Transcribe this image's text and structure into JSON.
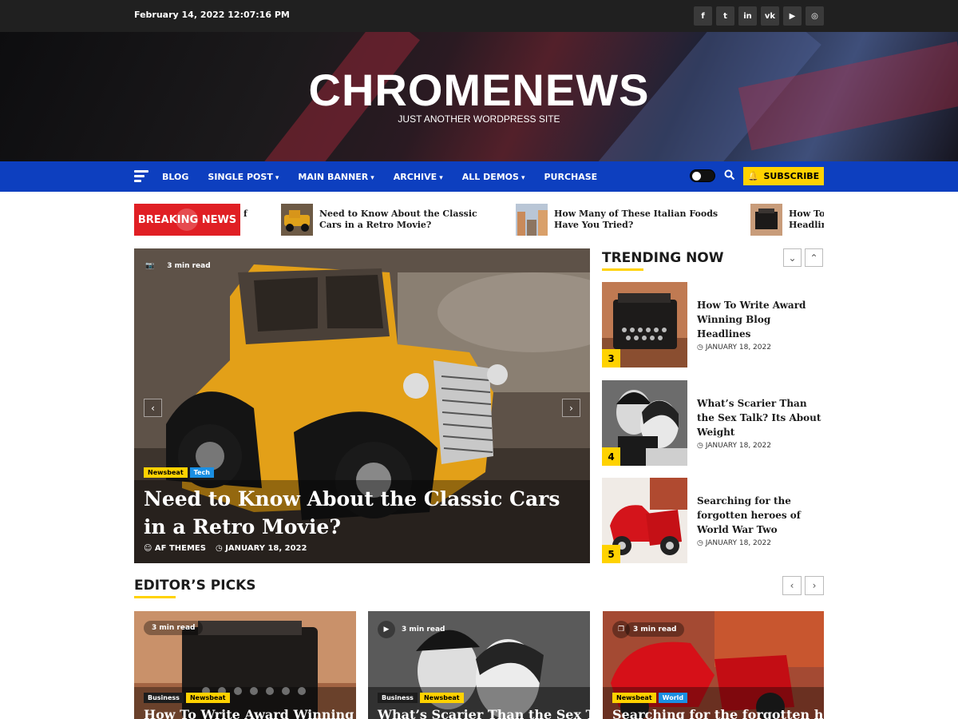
{
  "topbar": {
    "datetime": "February 14, 2022 12:07:16 PM",
    "socials": [
      {
        "icon": "facebook-icon",
        "glyph": "f"
      },
      {
        "icon": "twitter-icon",
        "glyph": "t"
      },
      {
        "icon": "linkedin-icon",
        "glyph": "in"
      },
      {
        "icon": "vk-icon",
        "glyph": "vk"
      },
      {
        "icon": "youtube-icon",
        "glyph": "▶"
      },
      {
        "icon": "instagram-icon",
        "glyph": "◎"
      }
    ]
  },
  "header": {
    "site_title": "CHROMENEWS",
    "site_description": "JUST ANOTHER WORDPRESS SITE"
  },
  "nav": {
    "items": [
      {
        "label": "BLOG",
        "dropdown": false
      },
      {
        "label": "SINGLE POST",
        "dropdown": true
      },
      {
        "label": "MAIN BANNER",
        "dropdown": true
      },
      {
        "label": "ARCHIVE",
        "dropdown": true
      },
      {
        "label": "ALL DEMOS",
        "dropdown": true
      },
      {
        "label": "PURCHASE",
        "dropdown": false
      }
    ],
    "subscribe_label": "SUBSCRIBE"
  },
  "breaking": {
    "label": "BREAKING NEWS",
    "fragment": "f",
    "items": [
      "Need to Know About the Classic Cars in a Retro Movie?",
      "How Many of These Italian Foods Have You Tried?",
      "How To Write Award Winning Blog Headlines"
    ]
  },
  "banner": {
    "read_time": "3 min read",
    "categories": [
      "Newsbeat",
      "Tech"
    ],
    "title": "Need to Know About the Classic Cars in a Retro Movie?",
    "author": "AF THEMES",
    "date": "JANUARY 18, 2022"
  },
  "trending": {
    "title": "TRENDING NOW",
    "items": [
      {
        "num": "3",
        "title": "How To Write Award Winning Blog Headlines",
        "date": "JANUARY 18, 2022"
      },
      {
        "num": "4",
        "title": "What’s Scarier Than the Sex Talk? Its About Weight",
        "date": "JANUARY 18, 2022"
      },
      {
        "num": "5",
        "title": "Searching for the forgotten heroes of World War Two",
        "date": "JANUARY 18, 2022"
      }
    ]
  },
  "editors_picks": {
    "title": "EDITOR’S PICKS",
    "cards": [
      {
        "read_time": "3 min read",
        "categories": [
          "Business",
          "Newsbeat"
        ],
        "title": "How To Write Award Winning Blog Headlines"
      },
      {
        "read_time": "3 min read",
        "categories": [
          "Business",
          "Newsbeat"
        ],
        "title": "What’s Scarier Than the Sex Talk? Its About Weight"
      },
      {
        "read_time": "3 min read",
        "categories": [
          "Newsbeat",
          "World"
        ],
        "title": "Searching for the forgotten heroes of World War Two"
      }
    ]
  },
  "colors": {
    "nav": "#0d3fbf",
    "accent": "#ffd200",
    "breaking": "#e01f24",
    "topbar": "#202020"
  }
}
